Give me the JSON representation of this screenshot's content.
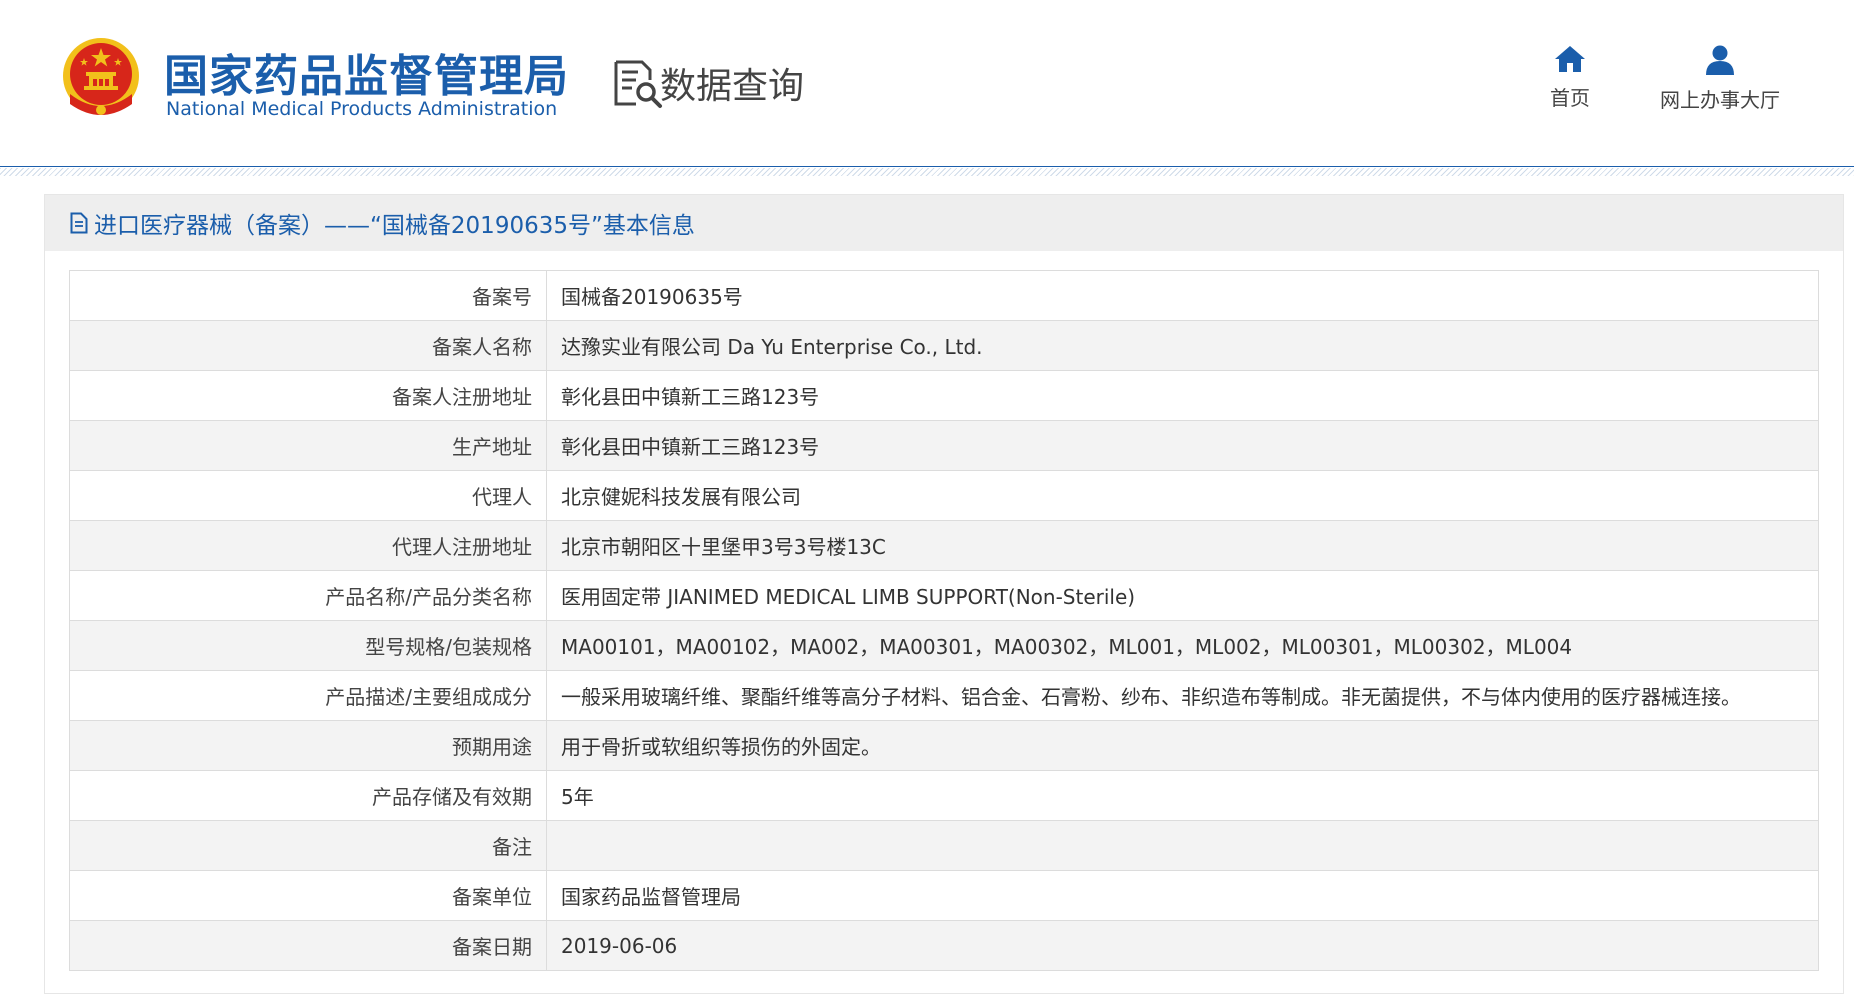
{
  "brand": {
    "name_cn": "国家药品监督管理局",
    "name_en": "National Medical Products Administration",
    "logo_icon": "national-emblem-icon"
  },
  "service": {
    "label": "数据查询",
    "icon": "document-search-icon"
  },
  "nav": [
    {
      "label": "首页",
      "icon": "home-icon"
    },
    {
      "label": "网上办事大厅",
      "icon": "user-icon"
    }
  ],
  "panel": {
    "title": "进口医疗器械（备案）——“国械备20190635号”基本信息",
    "icon": "document-icon"
  },
  "record": [
    {
      "label": "备案号",
      "value": "国械备20190635号"
    },
    {
      "label": "备案人名称",
      "value": "达豫实业有限公司 Da Yu Enterprise Co., Ltd."
    },
    {
      "label": "备案人注册地址",
      "value": "彰化县田中镇新工三路123号"
    },
    {
      "label": "生产地址",
      "value": "彰化县田中镇新工三路123号"
    },
    {
      "label": "代理人",
      "value": "北京健妮科技发展有限公司"
    },
    {
      "label": "代理人注册地址",
      "value": "北京市朝阳区十里堡甲3号3号楼13C"
    },
    {
      "label": "产品名称/产品分类名称",
      "value": "医用固定带 JIANIMED MEDICAL LIMB SUPPORT(Non-Sterile)"
    },
    {
      "label": "型号规格/包装规格",
      "value": "MA00101，MA00102，MA002，MA00301，MA00302，ML001，ML002，ML00301，ML00302，ML004"
    },
    {
      "label": "产品描述/主要组成成分",
      "value": "一般采用玻璃纤维、聚酯纤维等高分子材料、铝合金、石膏粉、纱布、非织造布等制成。非无菌提供，不与体内使用的医疗器械连接。"
    },
    {
      "label": "预期用途",
      "value": "用于骨折或软组织等损伤的外固定。"
    },
    {
      "label": "产品存储及有效期",
      "value": "5年"
    },
    {
      "label": "备注",
      "value": ""
    },
    {
      "label": "备案单位",
      "value": "国家药品监督管理局"
    },
    {
      "label": "备案日期",
      "value": "2019-06-06"
    }
  ],
  "colors": {
    "brand_blue": "#1b5eab",
    "emblem_red": "#d7261a",
    "emblem_gold": "#f2c01b",
    "row_alt": "#f3f3f3",
    "panel_head": "#eeeeee"
  }
}
